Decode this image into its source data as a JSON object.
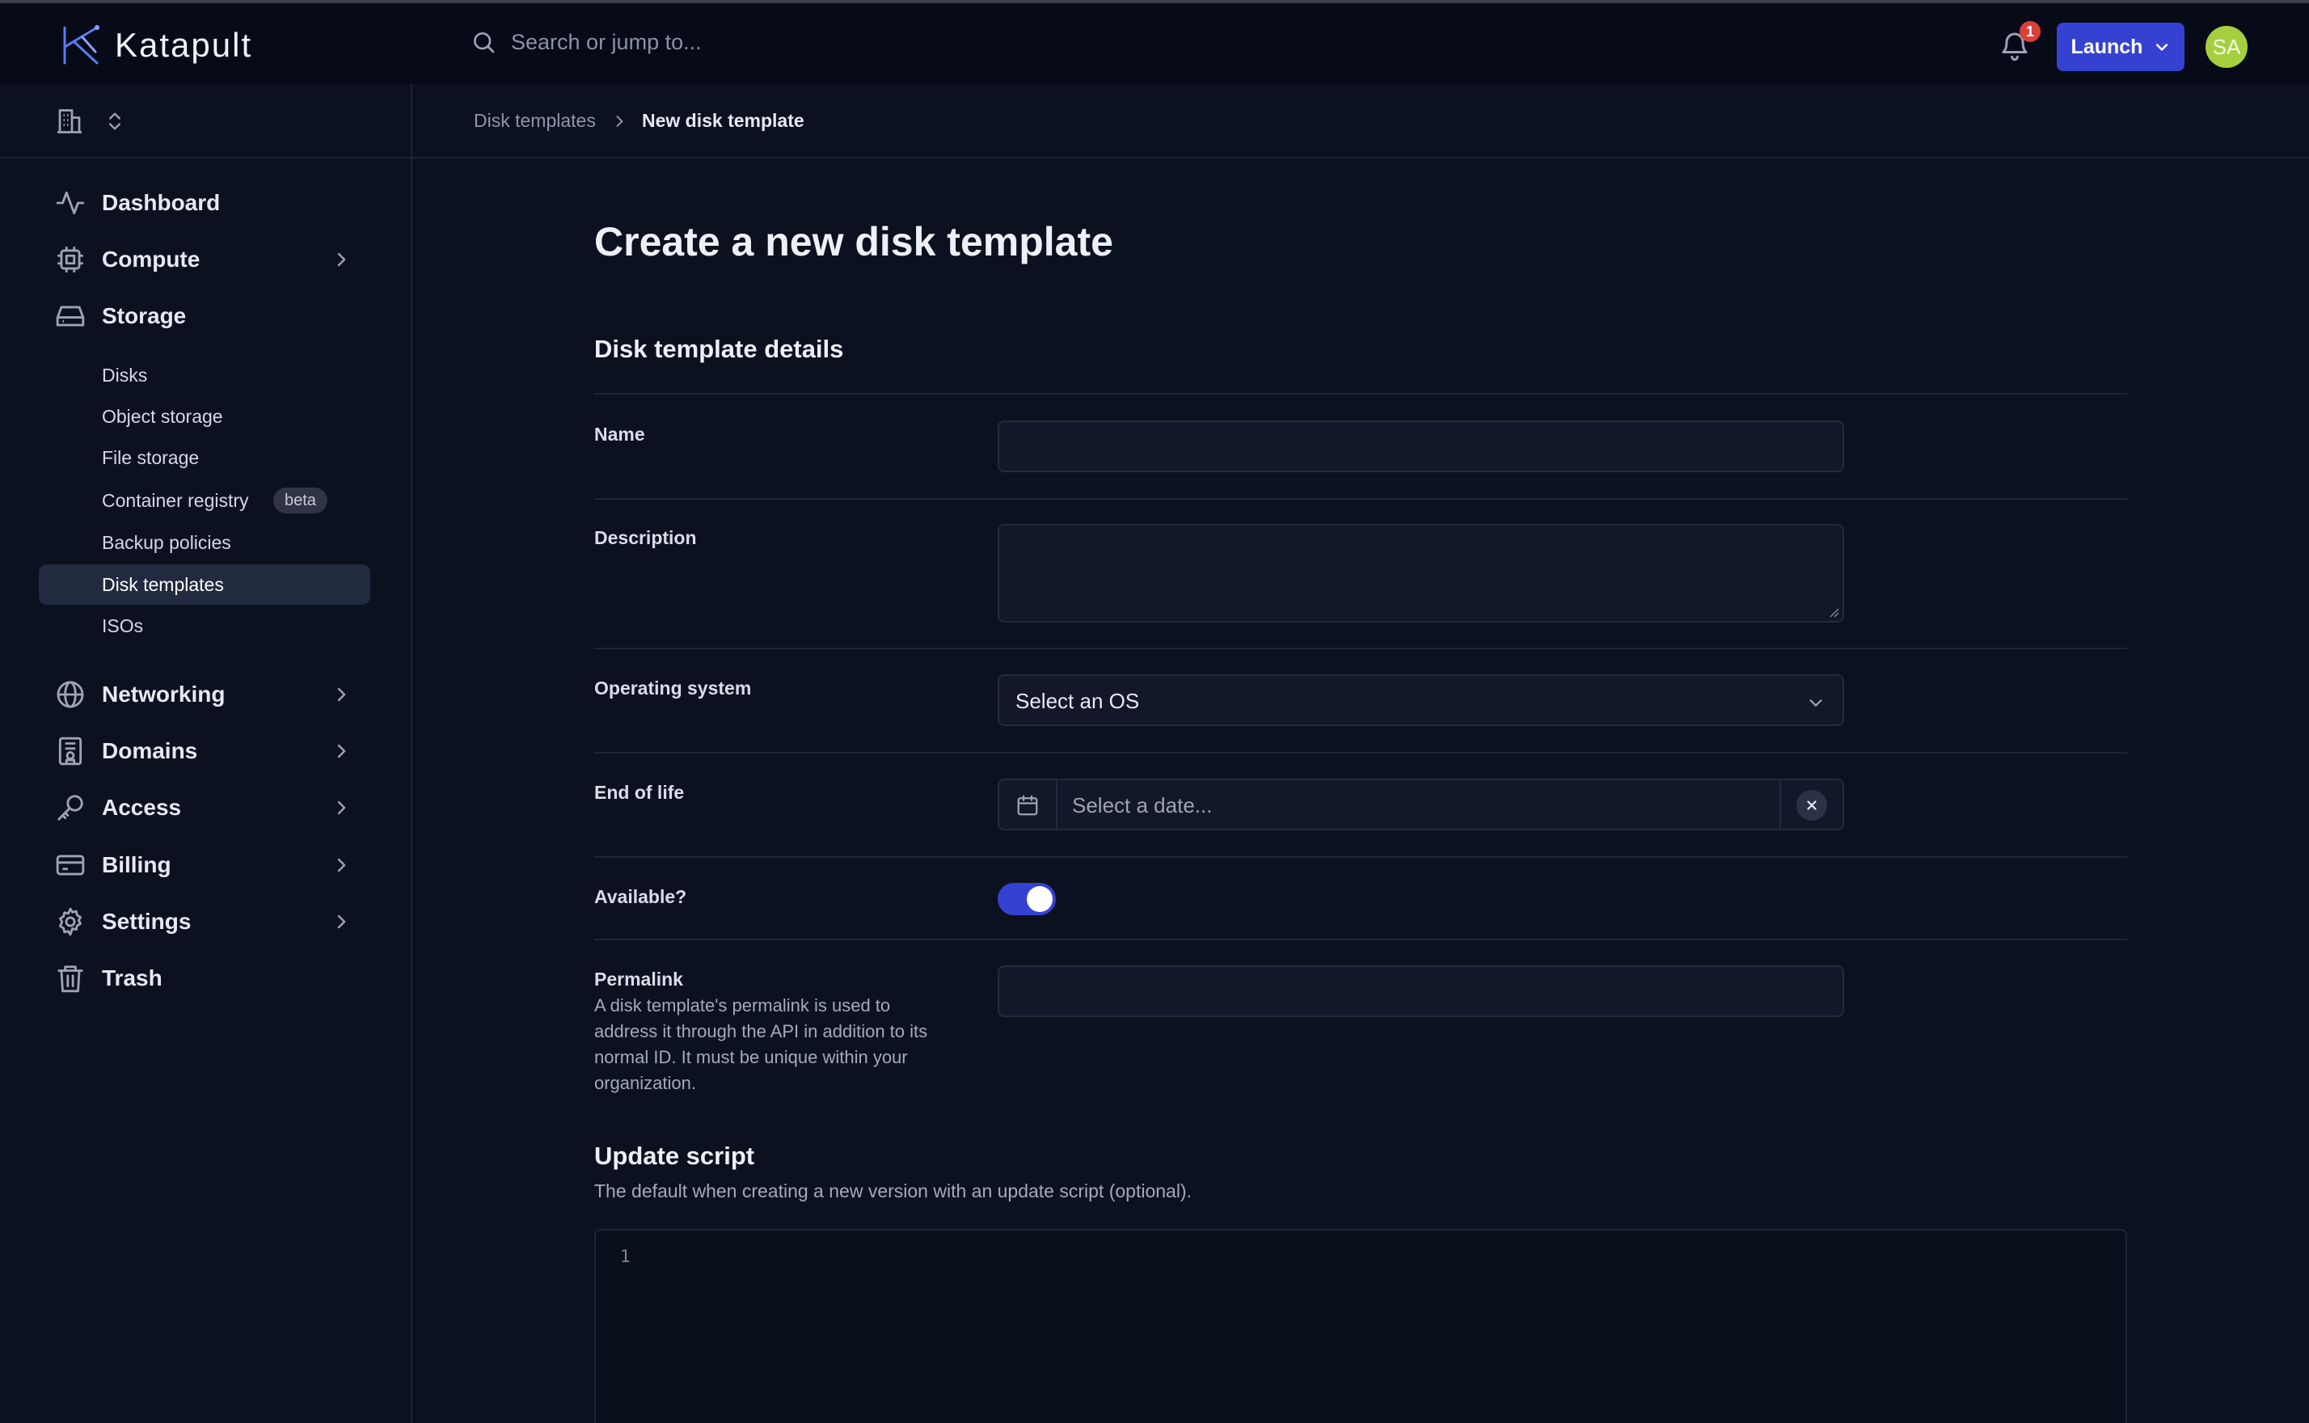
{
  "app": {
    "brand": "Katapult"
  },
  "topbar": {
    "search_placeholder": "Search or jump to...",
    "notification_count": "1",
    "launch_label": "Launch",
    "avatar_initials": "SA"
  },
  "sidebar": {
    "items": [
      {
        "label": "Dashboard",
        "icon": "activity-icon"
      },
      {
        "label": "Compute",
        "icon": "cpu-icon"
      },
      {
        "label": "Storage",
        "icon": "drive-icon"
      },
      {
        "label": "Networking",
        "icon": "globe-icon"
      },
      {
        "label": "Domains",
        "icon": "domain-icon"
      },
      {
        "label": "Access",
        "icon": "key-icon"
      },
      {
        "label": "Billing",
        "icon": "credit-card-icon"
      },
      {
        "label": "Settings",
        "icon": "gear-icon"
      },
      {
        "label": "Trash",
        "icon": "trash-icon"
      }
    ],
    "storage_sub": [
      {
        "label": "Disks"
      },
      {
        "label": "Object storage"
      },
      {
        "label": "File storage"
      },
      {
        "label": "Container registry",
        "badge": "beta"
      },
      {
        "label": "Backup policies"
      },
      {
        "label": "Disk templates",
        "active": true
      },
      {
        "label": "ISOs"
      }
    ]
  },
  "breadcrumb": {
    "parent": "Disk templates",
    "current": "New disk template"
  },
  "page": {
    "title": "Create a new disk template",
    "section_title": "Disk template details",
    "fields": {
      "name": {
        "label": "Name",
        "value": ""
      },
      "description": {
        "label": "Description",
        "value": ""
      },
      "os": {
        "label": "Operating system",
        "value": "Select an OS"
      },
      "eol": {
        "label": "End of life",
        "placeholder": "Select a date..."
      },
      "available": {
        "label": "Available?",
        "value": true
      },
      "permalink": {
        "label": "Permalink",
        "help": "A disk template's permalink is used to address it through the API in addition to its normal ID. It must be unique within your organization.",
        "value": ""
      }
    },
    "update_script": {
      "title": "Update script",
      "subtitle": "The default when creating a new version with an update script (optional).",
      "line_number": "1"
    }
  },
  "colors": {
    "accent": "#3542d1",
    "background": "#0c1120",
    "topbar": "#060b17",
    "avatar": "#a6cf3e",
    "badge": "#d9403a"
  }
}
